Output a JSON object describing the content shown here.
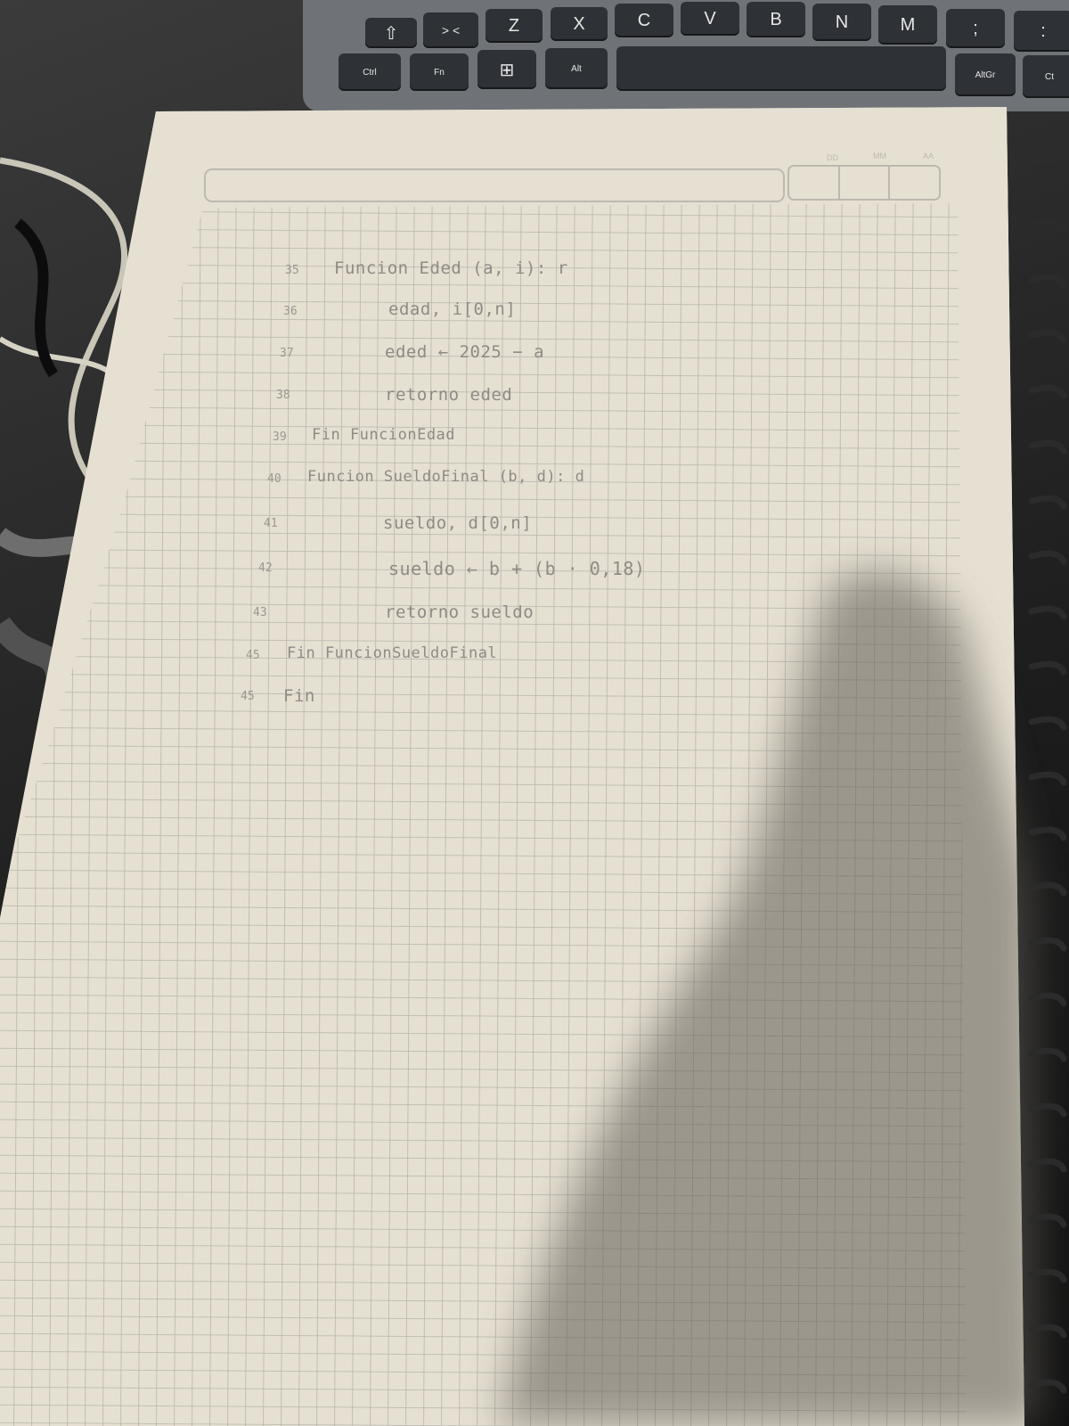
{
  "keyboard": {
    "keys": [
      {
        "label": "⇧",
        "name": "shift-key"
      },
      {
        "label": "> <",
        "name": "angle-bracket-key"
      },
      {
        "label": "Z",
        "name": "z-key"
      },
      {
        "label": "X",
        "name": "x-key"
      },
      {
        "label": "C",
        "name": "c-key"
      },
      {
        "label": "V",
        "name": "v-key"
      },
      {
        "label": "B",
        "name": "b-key"
      },
      {
        "label": "N",
        "name": "n-key"
      },
      {
        "label": "M",
        "name": "m-key"
      },
      {
        "label": ";",
        "name": "semicolon-key"
      },
      {
        "label": ":",
        "name": "colon-key"
      }
    ],
    "bottom_keys": [
      {
        "label": "Ctrl",
        "name": "ctrl-key"
      },
      {
        "label": "Fn",
        "name": "fn-key"
      },
      {
        "label": "⊞",
        "name": "windows-key"
      },
      {
        "label": "Alt",
        "name": "alt-key"
      },
      {
        "label": "",
        "name": "space-key"
      },
      {
        "label": "AltGr",
        "name": "altgr-key"
      },
      {
        "label": "Ct",
        "name": "right-ctrl-key"
      }
    ]
  },
  "notebook": {
    "date_fields": {
      "day": "DD",
      "month": "MM",
      "year": "AA"
    },
    "lines": [
      {
        "num": "35",
        "text": "Funcion Eded (a, i): r"
      },
      {
        "num": "36",
        "text": "edad, i[0,n]"
      },
      {
        "num": "37",
        "text": "eded ← 2025 − a"
      },
      {
        "num": "38",
        "text": "retorno eded"
      },
      {
        "num": "39",
        "text": "Fin FuncionEdad"
      },
      {
        "num": "40",
        "text": "Funcion SueldoFinal (b, d): d"
      },
      {
        "num": "41",
        "text": "sueldo, d[0,n]"
      },
      {
        "num": "42",
        "text": "sueldo ← b + (b · 0,18)"
      },
      {
        "num": "43",
        "text": "retorno sueldo"
      },
      {
        "num": "45",
        "text": "Fin FuncionSueldoFinal"
      },
      {
        "num": "45",
        "text": "Fin"
      }
    ]
  },
  "colors": {
    "paper": "#e9e3d6",
    "grid": "#b9b5ae",
    "ink": "#8f8a85",
    "shadow": "#6d6a63"
  }
}
